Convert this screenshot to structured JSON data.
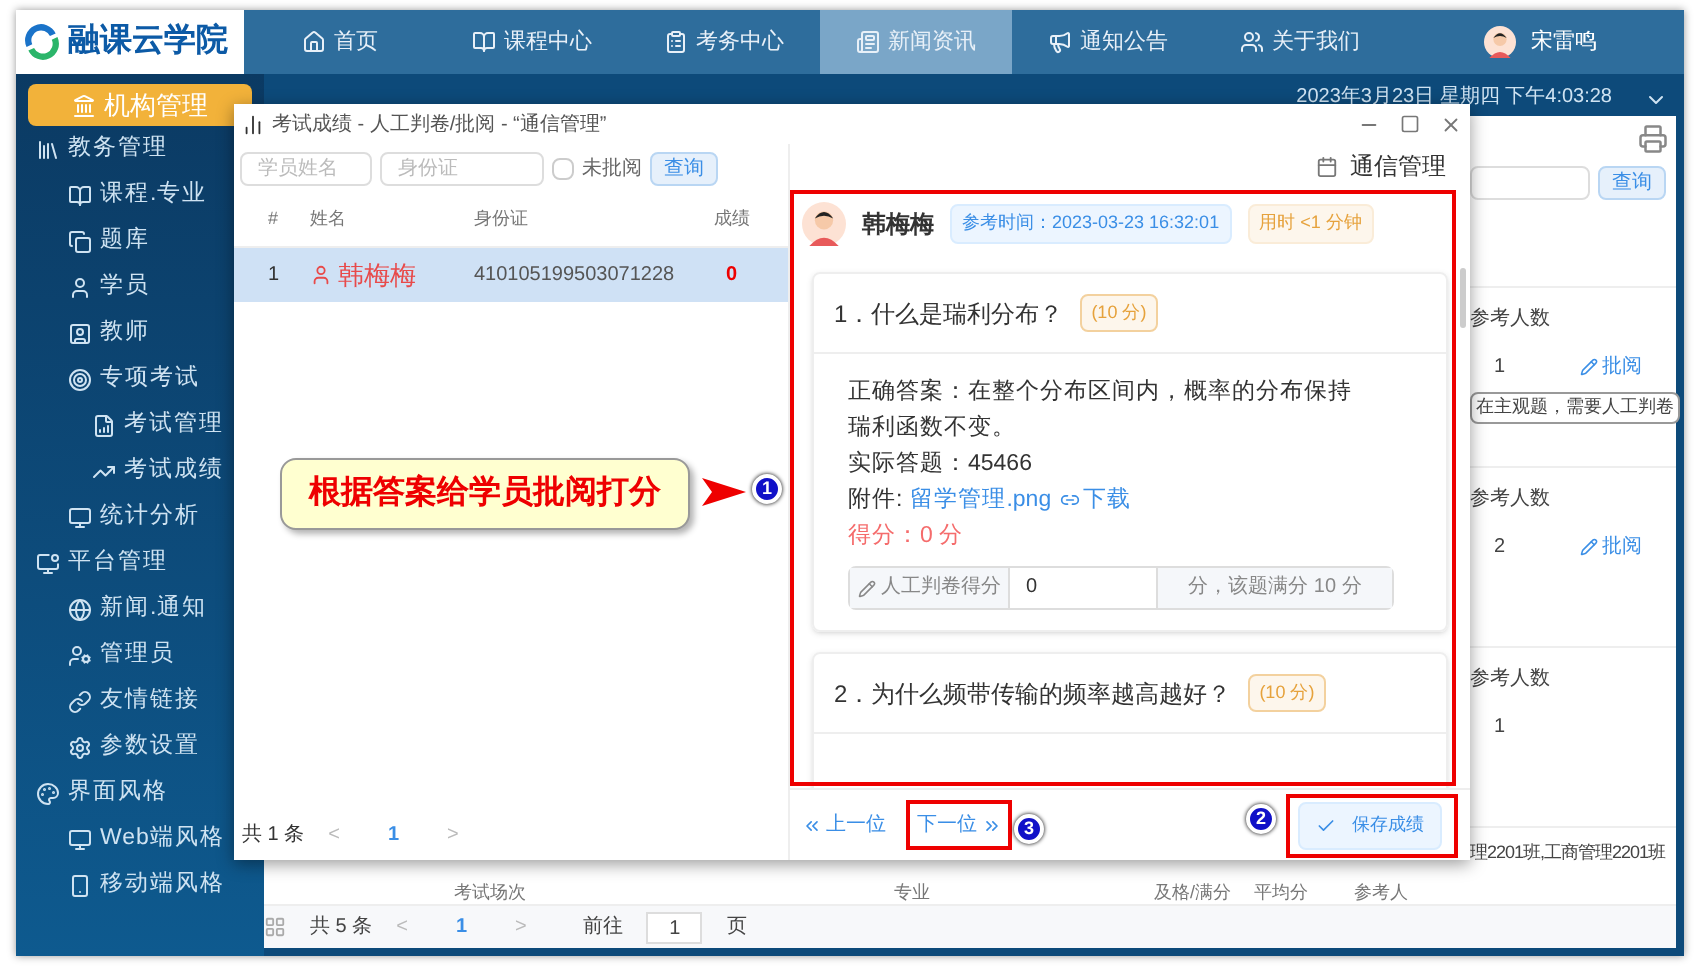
{
  "app": {
    "logo": "融课云学院",
    "user": "宋雷鸣",
    "datetime": "2023年3月23日 星期四 下午4:03:28"
  },
  "nav": [
    {
      "label": "首页",
      "selected": false
    },
    {
      "label": "课程中心",
      "selected": false
    },
    {
      "label": "考务中心",
      "selected": false
    },
    {
      "label": "新闻资讯",
      "selected": true
    },
    {
      "label": "通知公告",
      "selected": false
    },
    {
      "label": "关于我们",
      "selected": false
    }
  ],
  "sidebar": {
    "header": "机构管理",
    "items": [
      {
        "label": "教务管理",
        "children": [
          {
            "label": "课程.专业"
          },
          {
            "label": "题库"
          },
          {
            "label": "学员"
          },
          {
            "label": "教师"
          },
          {
            "label": "专项考试",
            "children": [
              {
                "label": "考试管理"
              },
              {
                "label": "考试成绩"
              }
            ]
          },
          {
            "label": "统计分析"
          }
        ]
      },
      {
        "label": "平台管理",
        "children": [
          {
            "label": "新闻.通知"
          },
          {
            "label": "管理员"
          },
          {
            "label": "友情链接"
          },
          {
            "label": "参数设置"
          }
        ]
      },
      {
        "label": "界面风格",
        "children": [
          {
            "label": "Web端风格"
          },
          {
            "label": "移动端风格"
          }
        ]
      }
    ]
  },
  "background": {
    "search_button": "查询",
    "rows": [
      {
        "header": "参考人数",
        "count": "1",
        "action": "批阅",
        "tooltip": "在主观题，需要人工判卷"
      },
      {
        "header": "参考人数",
        "count": "2",
        "action": "批阅"
      },
      {
        "header": "参考人数",
        "count": "1"
      }
    ],
    "classes": "理2201班,工商管理2201班",
    "columns": [
      "考试场次",
      "专业",
      "及格/满分",
      "平均分",
      "参考人"
    ],
    "pagination": {
      "total": "共 5 条",
      "prev": "<",
      "page": "1",
      "next": ">",
      "goto": "前往",
      "goto_value": "1",
      "unit": "页"
    }
  },
  "dialog": {
    "title": "考试成绩 - 人工判卷/批阅 - “通信管理”",
    "exam": "通信管理",
    "search": {
      "name_placeholder": "学员姓名",
      "id_placeholder": "身份证",
      "unmarked_label": "未批阅",
      "unmarked_checked": false,
      "button": "查询"
    },
    "columns": [
      "#",
      "姓名",
      "身份证",
      "成绩"
    ],
    "students": [
      {
        "index": "1",
        "name": "韩梅梅",
        "id": "410105199503071228",
        "score": "0",
        "selected": true
      }
    ],
    "pagination": {
      "total": "共 1 条",
      "prev": "<",
      "page": "1",
      "next": ">"
    },
    "detail": {
      "name": "韩梅梅",
      "time_tag": "参考时间：2023-03-23 16:32:01",
      "duration_tag": "用时 <1 分钟",
      "questions": [
        {
          "title": "1．什么是瑞利分布？",
          "points": "(10 分)",
          "answer": "正确答案：在整个分布区间内，概率的分布保持瑞利函数不变。",
          "actual": "实际答题：45466",
          "attachment_label": "附件:",
          "attachment": "留学管理.png",
          "download": "下载",
          "score": "得分：0 分",
          "grade_label": "人工判卷得分",
          "grade_value": "0",
          "grade_suffix": "分，该题满分 10 分"
        },
        {
          "title": "2．为什么频带传输的频率越高越好？",
          "points": "(10 分)"
        }
      ]
    },
    "prev": "上一位",
    "next": "下一位",
    "save": "保存成绩"
  },
  "annotations": {
    "callout": "根据答案给学员批阅打分",
    "markers": [
      "1",
      "2",
      "3"
    ]
  }
}
